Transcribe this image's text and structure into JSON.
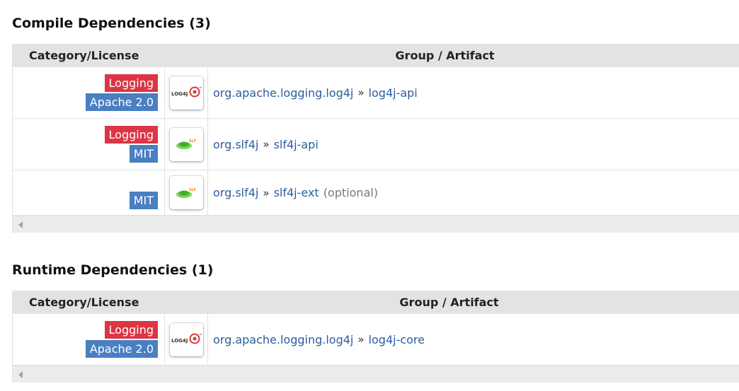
{
  "compile": {
    "title": "Compile Dependencies (3)",
    "headers": {
      "category": "Category/License",
      "artifact": "Group / Artifact"
    },
    "rows": [
      {
        "badges": [
          "Logging",
          "Apache 2.0"
        ],
        "logo": "log4j-logo",
        "group": "org.apache.logging.log4j",
        "artifact": "log4j-api",
        "note": ""
      },
      {
        "badges": [
          "Logging",
          "MIT"
        ],
        "logo": "slf4j-logo",
        "group": "org.slf4j",
        "artifact": "slf4j-api",
        "note": ""
      },
      {
        "badges": [
          "MIT"
        ],
        "logo": "slf4j-logo",
        "group": "org.slf4j",
        "artifact": "slf4j-ext",
        "note": "(optional)"
      }
    ]
  },
  "runtime": {
    "title": "Runtime Dependencies (1)",
    "headers": {
      "category": "Category/License",
      "artifact": "Group / Artifact"
    },
    "rows": [
      {
        "badges": [
          "Logging",
          "Apache 2.0"
        ],
        "logo": "log4j-logo",
        "group": "org.apache.logging.log4j",
        "artifact": "log4j-core",
        "note": ""
      }
    ]
  },
  "separator": "»",
  "colors": {
    "logging_badge": "#dc3545",
    "license_badge": "#4a7fc1",
    "link": "#2a5d9f",
    "header_bg": "#e3e3e3"
  }
}
